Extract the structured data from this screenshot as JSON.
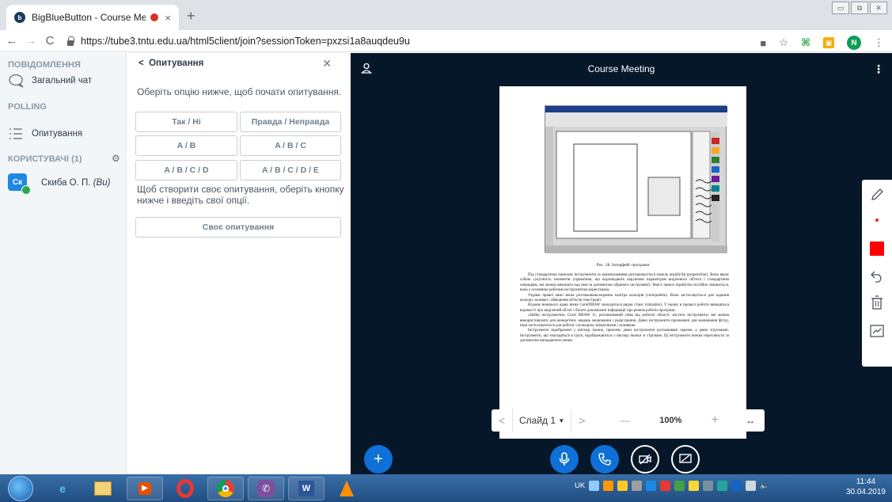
{
  "browser": {
    "tab_title": "BigBlueButton - Course Mee",
    "tab_close": "×",
    "new_tab": "+",
    "url": "https://tube3.tntu.edu.ua/html5client/join?sessionToken=pxzsi1a8auqdeu9u",
    "profile_initial": "N",
    "window_buttons": [
      "▭",
      "⧉",
      "✕"
    ]
  },
  "leftnav": {
    "messages_title": "ПОВІДОМЛЕННЯ",
    "public_chat": "Загальний чат",
    "polling_title": "POLLING",
    "polling_item": "Опитування",
    "users_title": "КОРИСТУВАЧІ (1)",
    "user_initials": "Ск",
    "user_name": "Скиба О. П.",
    "user_you": "(Ви)"
  },
  "poll": {
    "header": "Опитування",
    "back": "<",
    "close": "✕",
    "hint": "Оберіть опцію нижче, щоб почати опитування.",
    "options": [
      "Так / Ні",
      "Правда / Неправда",
      "A / B",
      "A / B / C",
      "A / B / C / D",
      "A / B / C / D / E"
    ],
    "custom_hint": "Щоб створити своє опитування, оберіть кнопку нижче і введіть свої опції.",
    "custom_button": "Своє опитування"
  },
  "presentation": {
    "title": "Course Meeting",
    "slide_label": "Слайд 1",
    "slide_dropdown": "▼",
    "zoom": "100%",
    "zoom_minus": "—",
    "zoom_plus": "+",
    "fit": "↔",
    "prev": "<",
    "next": ">",
    "caption": "Рис. 18. Інтерфейс програми",
    "paragraphs": [
      "Під стандартною панеллю інструментів за замовчуванням розташовується панель атрибутів (propertybar). Вона являє собою сукупність елементів управління, що відповідають керуючим параметрам виділеного об'єкта і стандартним операціям, які можна виконати над ним за допомогою обраного інструменту. Вміст панелі атрибутів постійно змінюється, вона є основним робочим інструментом користувача.",
      "Уздовж правої межі вікна розташована-екранна палітра кольорів (colorpalette). Вона застосовується для задання кольору заливки і обведення об'єктів ілюстрації.",
      "Вздовж нижнього краю вікна CorelDRAW знаходиться рядок стану (statusbar). У ньому в процесі роботи виводяться відомості про виділений об'єкт і багато допоміжної інформації про режим роботи програми.",
      "«Набір інструментів» Corel DRAW 11, розташований зліва від робочої області, містить інструменти, які можна використовувати для конкретних завдань малювання і редагування. Деякі інструменти призначені для малювання фігур, інші застосовуються для роботи з кольором, візерунками і заливкою.",
      "Інструменти відображені у вигляді іконок, причому деякі інструменти розташовані окремо, а деякі згруповані. Інструменти, що знаходяться в групі, відображаються у вигляді іконки зі стрілкою. Ці інструменти можна переглянути за допомогою випадаючого меню."
    ]
  },
  "tools": {
    "color": "#ff0000"
  },
  "taskbar": {
    "lang": "UK",
    "time": "11:44",
    "date": "30.04.2019"
  }
}
